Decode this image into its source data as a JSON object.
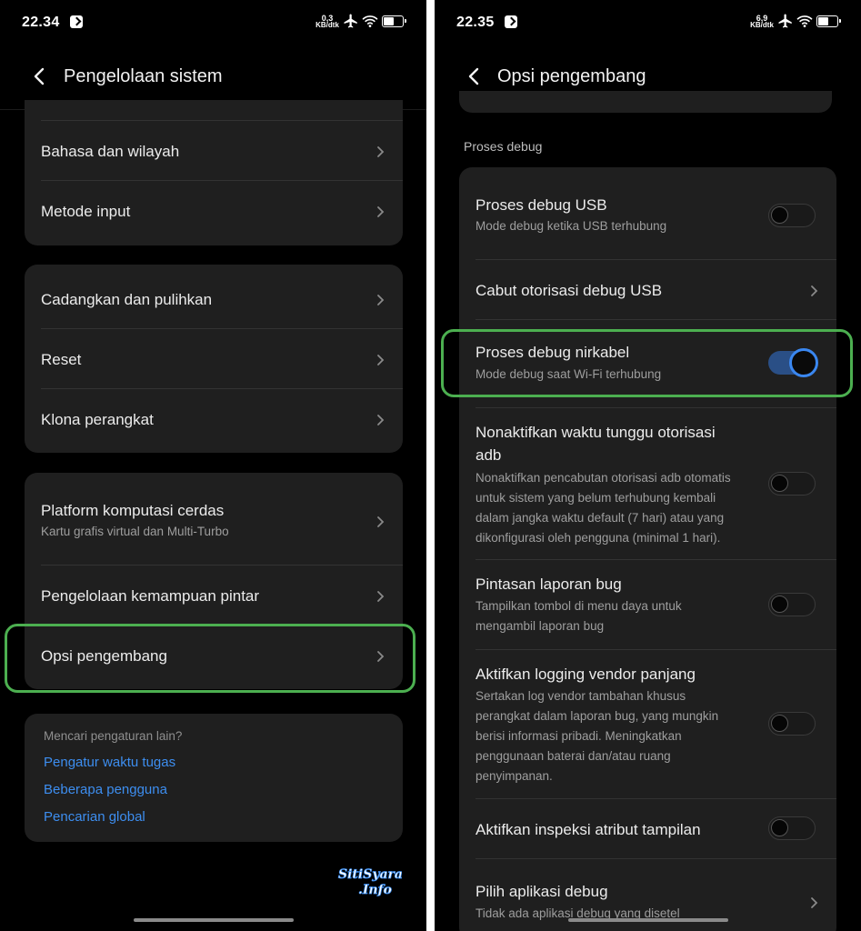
{
  "left": {
    "status": {
      "time": "22.34",
      "speed_value": "0,3",
      "speed_unit": "KB/dtk"
    },
    "header": {
      "title": "Pengelolaan sistem"
    },
    "group1": [
      {
        "title": "Bahasa dan wilayah"
      },
      {
        "title": "Metode input"
      }
    ],
    "group2": [
      {
        "title": "Cadangkan dan pulihkan"
      },
      {
        "title": "Reset"
      },
      {
        "title": "Klona perangkat"
      }
    ],
    "group3": [
      {
        "title": "Platform komputasi cerdas",
        "subtitle": "Kartu grafis virtual dan Multi-Turbo"
      },
      {
        "title": "Pengelolaan kemampuan pintar"
      },
      {
        "title": "Opsi pengembang"
      }
    ],
    "search": {
      "hint": "Mencari pengaturan lain?",
      "links": [
        "Pengatur waktu tugas",
        "Beberapa pengguna",
        "Pencarian global"
      ]
    },
    "watermark": {
      "line1": "SitiSyarah",
      "line2": ".Info"
    }
  },
  "right": {
    "status": {
      "time": "22.35",
      "speed_value": "6,9",
      "speed_unit": "KB/dtk"
    },
    "header": {
      "title": "Opsi pengembang"
    },
    "section_label": "Proses debug",
    "items": [
      {
        "title": "Proses debug USB",
        "subtitle": "Mode debug ketika USB terhubung",
        "control": "toggle",
        "state": "off"
      },
      {
        "title": "Cabut otorisasi debug USB",
        "control": "chevron"
      },
      {
        "title": "Proses debug nirkabel",
        "subtitle": "Mode debug saat Wi-Fi terhubung",
        "control": "toggle",
        "state": "on"
      },
      {
        "title_lines": [
          "Nonaktifkan waktu tunggu otorisasi",
          "adb"
        ],
        "subtitle_lines": [
          "Nonaktifkan pencabutan otorisasi adb otomatis",
          "untuk sistem yang belum terhubung kembali",
          "dalam jangka waktu default (7 hari) atau yang",
          "dikonfigurasi oleh pengguna (minimal 1 hari)."
        ],
        "control": "toggle",
        "state": "off"
      },
      {
        "title": "Pintasan laporan bug",
        "subtitle_lines": [
          "Tampilkan tombol di menu daya untuk",
          "mengambil laporan bug"
        ],
        "control": "toggle",
        "state": "off"
      },
      {
        "title": "Aktifkan logging vendor panjang",
        "subtitle_lines": [
          "Sertakan log vendor tambahan khusus",
          "perangkat dalam laporan bug, yang mungkin",
          "berisi informasi pribadi. Meningkatkan",
          "penggunaan baterai dan/atau ruang",
          "penyimpanan."
        ],
        "control": "toggle",
        "state": "off"
      },
      {
        "title": "Aktifkan inspeksi atribut tampilan",
        "control": "toggle",
        "state": "off"
      },
      {
        "title": "Pilih aplikasi debug",
        "subtitle": "Tidak ada aplikasi debug yang disetel",
        "control": "chevron"
      }
    ]
  },
  "colors": {
    "highlight": "#4caf50",
    "link": "#3d8ef0",
    "toggle_on": "#3a87f0",
    "card": "#1f1f1f"
  }
}
